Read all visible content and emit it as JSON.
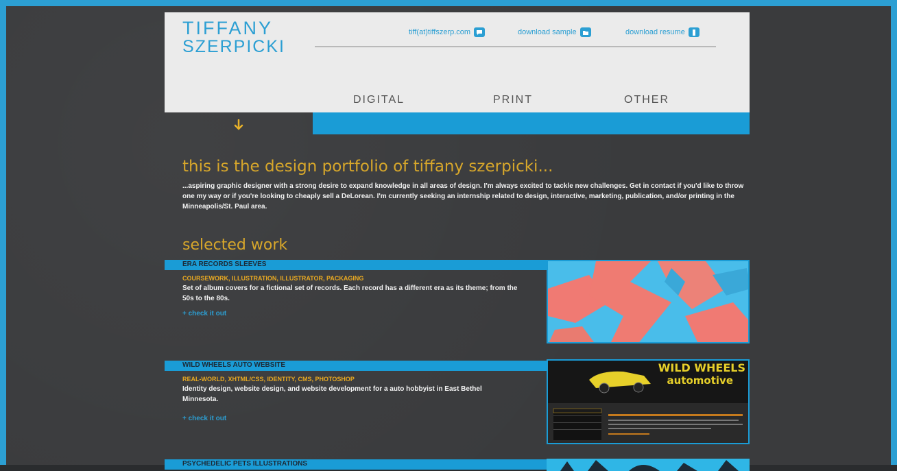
{
  "header": {
    "logo_line1": "TIFFANY",
    "logo_line2": "SZERPICKI",
    "contact": [
      {
        "label": "tiff(at)tiffszerp.com",
        "icon": "chat-icon"
      },
      {
        "label": "download sample",
        "icon": "folder-icon"
      },
      {
        "label": "download resume",
        "icon": "document-icon"
      }
    ],
    "nav": [
      "DIGITAL",
      "PRINT",
      "OTHER"
    ]
  },
  "intro": {
    "title": "this is the design portfolio of tiffany szerpicki...",
    "text": "...aspiring graphic designer with a strong desire to expand knowledge in all areas of design. I'm always excited to tackle new challenges. Get in contact if you'd like to throw one my way or if you're looking to cheaply sell a DeLorean. I'm currently seeking an internship related to design, interactive, marketing, publication, and/or printing in the Minneapolis/St. Paul area."
  },
  "selected_work": {
    "title": "selected work",
    "link_label": "+ check it out",
    "items": [
      {
        "title": "ERA RECORDS SLEEVES",
        "tags": "COURSEWORK, ILLUSTRATION, ILLUSTRATOR, PACKAGING",
        "desc": "Set of album covers for a fictional set of records. Each record has a different era as its theme; from the 50s to the 80s."
      },
      {
        "title": "WILD WHEELS AUTO WEBSITE",
        "tags": "REAL-WORLD, XHTML/CSS, IDENTITY, CMS, PHOTOSHOP",
        "desc": "Identity design, website design, and website development for a auto hobbyist in East Bethel Minnesota.",
        "thumb_heading": "WILD WHEELS",
        "thumb_subheading": "automotive"
      },
      {
        "title": "PSYCHEDELIC PETS ILLUSTRATIONS"
      }
    ]
  },
  "colors": {
    "accent_blue": "#1a9cd6",
    "accent_gold": "#d7a72b",
    "background": "#3a3b3d",
    "header_bg": "#ebebeb"
  }
}
